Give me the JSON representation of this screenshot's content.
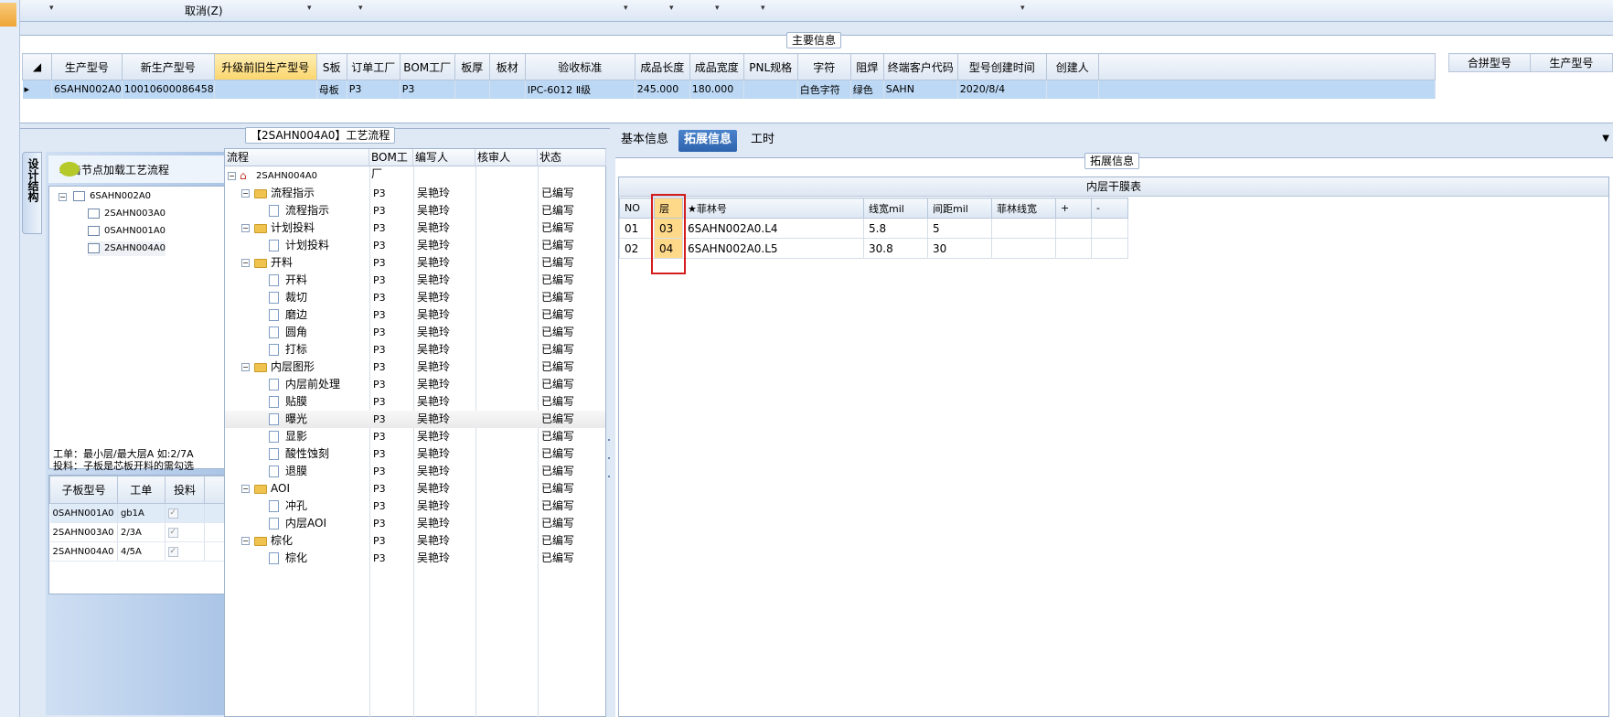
{
  "toolbar": {
    "cancel_label": "取消(Z)",
    "dropdown_glyph": "▾"
  },
  "main_info": {
    "legend": "主要信息",
    "columns": [
      "生产型号",
      "新生产型号",
      "升级前旧生产型号",
      "S板",
      "订单工厂",
      "BOM工厂",
      "板厚",
      "板材",
      "验收标准",
      "成品长度",
      "成品宽度",
      "PNL规格",
      "字符",
      "阻焊",
      "终端客户代码",
      "型号创建时间",
      "创建人"
    ],
    "row": [
      "6SAHN002A0",
      "10010600086458",
      "",
      "母板",
      "P3",
      "P3",
      "",
      "",
      "IPC-6012 Ⅱ级",
      "245.000",
      "180.000",
      "",
      "白色字符",
      "绿色",
      "SAHN",
      "2020/8/4",
      ""
    ],
    "right_columns": [
      "合拼型号",
      "生产型号"
    ]
  },
  "workflow": {
    "title": "【2SAHN004A0】工艺流程",
    "side_tab": "设计结构",
    "load_hint": "单击节点加载工艺流程",
    "tree": [
      {
        "label": "6SAHN002A0"
      },
      {
        "label": "2SAHN003A0"
      },
      {
        "label": "0SAHN001A0"
      },
      {
        "label": "2SAHN004A0"
      }
    ],
    "note_line1": "工单：最小层/最大层A 如:2/7A",
    "note_line2": "投料：子板是芯板开料的需勾选",
    "sub_columns": [
      "子板型号",
      "工单",
      "投料"
    ],
    "sub_rows": [
      {
        "model": "0SAHN001A0",
        "order": "gb1A",
        "feed": "✓"
      },
      {
        "model": "2SAHN003A0",
        "order": "2/3A",
        "feed": "✓"
      },
      {
        "model": "2SAHN004A0",
        "order": "4/5A",
        "feed": "✓"
      }
    ]
  },
  "process": {
    "columns": [
      "流程",
      "BOM工厂",
      "编写人",
      "核审人",
      "状态"
    ],
    "root": "2SAHN004A0",
    "rows": [
      {
        "name": "流程指示",
        "bom": "P3",
        "author": "吴艳玲",
        "status": "已编写"
      },
      {
        "name": "流程指示",
        "bom": "P3",
        "author": "吴艳玲",
        "status": "已编写"
      },
      {
        "name": "计划投料",
        "bom": "P3",
        "author": "吴艳玲",
        "status": "已编写"
      },
      {
        "name": "计划投料",
        "bom": "P3",
        "author": "吴艳玲",
        "status": "已编写"
      },
      {
        "name": "开料",
        "bom": "P3",
        "author": "吴艳玲",
        "status": "已编写"
      },
      {
        "name": "开料",
        "bom": "P3",
        "author": "吴艳玲",
        "status": "已编写"
      },
      {
        "name": "裁切",
        "bom": "P3",
        "author": "吴艳玲",
        "status": "已编写"
      },
      {
        "name": "磨边",
        "bom": "P3",
        "author": "吴艳玲",
        "status": "已编写"
      },
      {
        "name": "圆角",
        "bom": "P3",
        "author": "吴艳玲",
        "status": "已编写"
      },
      {
        "name": "打标",
        "bom": "P3",
        "author": "吴艳玲",
        "status": "已编写"
      },
      {
        "name": "内层图形",
        "bom": "P3",
        "author": "吴艳玲",
        "status": "已编写"
      },
      {
        "name": "内层前处理",
        "bom": "P3",
        "author": "吴艳玲",
        "status": "已编写"
      },
      {
        "name": "贴膜",
        "bom": "P3",
        "author": "吴艳玲",
        "status": "已编写"
      },
      {
        "name": "曝光",
        "bom": "P3",
        "author": "吴艳玲",
        "status": "已编写"
      },
      {
        "name": "显影",
        "bom": "P3",
        "author": "吴艳玲",
        "status": "已编写"
      },
      {
        "name": "酸性蚀刻",
        "bom": "P3",
        "author": "吴艳玲",
        "status": "已编写"
      },
      {
        "name": "退膜",
        "bom": "P3",
        "author": "吴艳玲",
        "status": "已编写"
      },
      {
        "name": "AOI",
        "bom": "P3",
        "author": "吴艳玲",
        "status": "已编写"
      },
      {
        "name": "冲孔",
        "bom": "P3",
        "author": "吴艳玲",
        "status": "已编写"
      },
      {
        "name": "内层AOI",
        "bom": "P3",
        "author": "吴艳玲",
        "status": "已编写"
      },
      {
        "name": "棕化",
        "bom": "P3",
        "author": "吴艳玲",
        "status": "已编写"
      },
      {
        "name": "棕化",
        "bom": "P3",
        "author": "吴艳玲",
        "status": "已编写"
      }
    ]
  },
  "right": {
    "tabs": [
      "基本信息",
      "拓展信息",
      "工时"
    ],
    "ext_legend": "拓展信息",
    "table_title": "内层干膜表",
    "columns": [
      "NO",
      "层",
      "★菲林号",
      "线宽mil",
      "间距mil",
      "菲林线宽",
      "+",
      "-"
    ],
    "rows": [
      {
        "no": "01",
        "layer": "03",
        "film": "6SAHN002A0.L4",
        "width": "5.8",
        "spacing": "5",
        "film_width": ""
      },
      {
        "no": "02",
        "layer": "04",
        "film": "6SAHN002A0.L5",
        "width": "30.8",
        "spacing": "30",
        "film_width": ""
      }
    ]
  },
  "colors": {
    "accent": "#2e63ad",
    "highlight": "#ffd98a",
    "annotation": "#d41e1e"
  }
}
